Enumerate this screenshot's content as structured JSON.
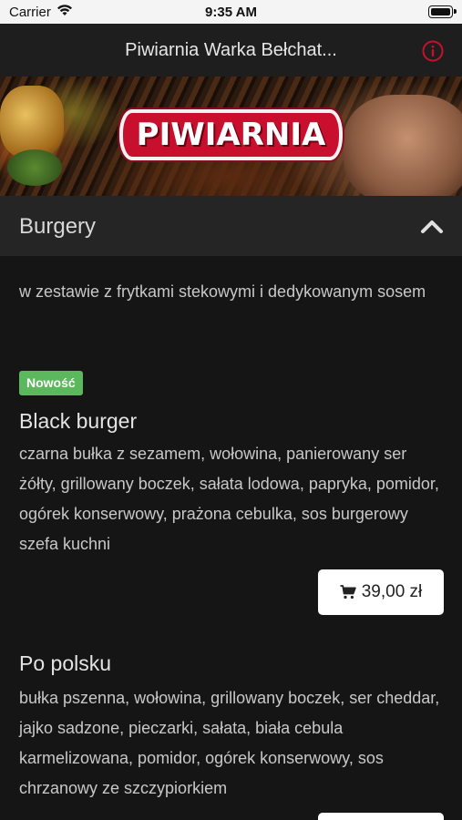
{
  "status_bar": {
    "carrier": "Carrier",
    "time": "9:35 AM"
  },
  "nav": {
    "title": "Piwiarnia Warka Bełchat...",
    "info_icon": "info-circle-icon"
  },
  "hero": {
    "logo_text": "PIWIARNIA"
  },
  "category": {
    "title": "Burgery",
    "description": "w zestawie z frytkami stekowymi i dedykowanym sosem",
    "expanded": true
  },
  "items": [
    {
      "badge": "Nowość",
      "name": "Black burger",
      "description": "czarna bułka z sezamem, wołowina, panierowany ser żółty, grillowany boczek, sałata lodowa, papryka, pomidor, ogórek konserwowy, prażona cebulka, sos burgerowy szefa kuchni",
      "price": "39,00 zł"
    },
    {
      "name": "Po polsku",
      "description": "bułka pszenna, wołowina, grillowany boczek, ser cheddar, jajko sadzone, pieczarki, sałata, biała cebula karmelizowana, pomidor, ogórek konserwowy, sos chrzanowy ze szczypiorkiem"
    }
  ],
  "colors": {
    "background": "#151515",
    "header": "#252525",
    "badge_green": "#5cb85c",
    "info_red": "#c8102e"
  }
}
